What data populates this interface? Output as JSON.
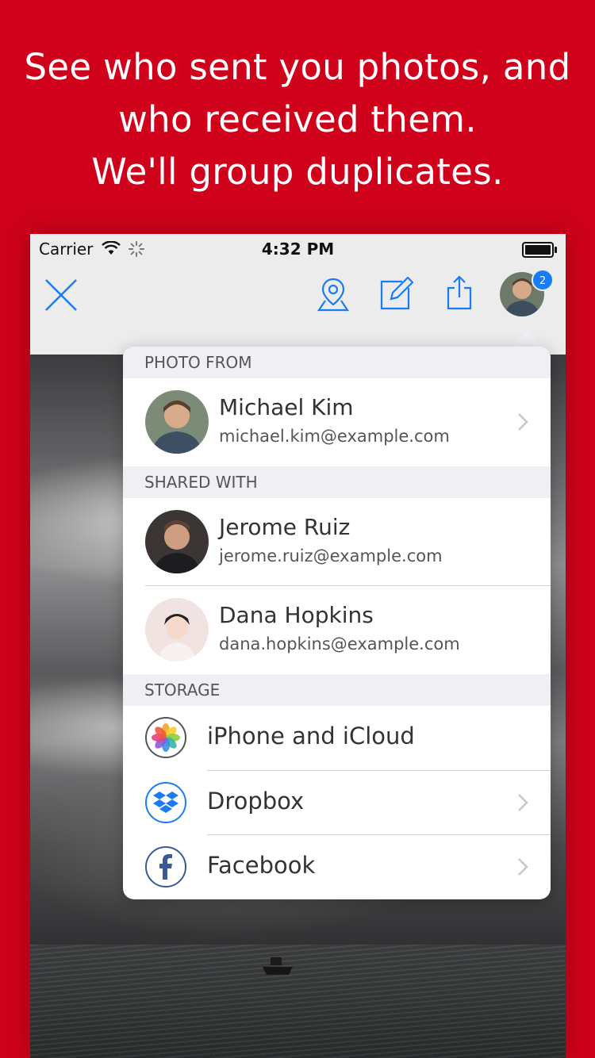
{
  "headline": {
    "line1": "See who sent you photos, and",
    "line2": "who received them.",
    "line3": "We'll group duplicates."
  },
  "status_bar": {
    "carrier": "Carrier",
    "time": "4:32 PM"
  },
  "nav": {
    "badge_count": "2"
  },
  "photo_from": {
    "header": "PHOTO FROM",
    "name": "Michael Kim",
    "email": "michael.kim@example.com"
  },
  "shared_with": {
    "header": "SHARED WITH",
    "people": [
      {
        "name": "Jerome Ruiz",
        "email": "jerome.ruiz@example.com"
      },
      {
        "name": "Dana Hopkins",
        "email": "dana.hopkins@example.com"
      }
    ]
  },
  "storage": {
    "header": "STORAGE",
    "items": [
      {
        "label": "iPhone and iCloud",
        "icon": "photos-icon"
      },
      {
        "label": "Dropbox",
        "icon": "dropbox-icon"
      },
      {
        "label": "Facebook",
        "icon": "facebook-icon"
      }
    ]
  },
  "colors": {
    "background": "#d0021b",
    "accent": "#1a7cf5"
  }
}
